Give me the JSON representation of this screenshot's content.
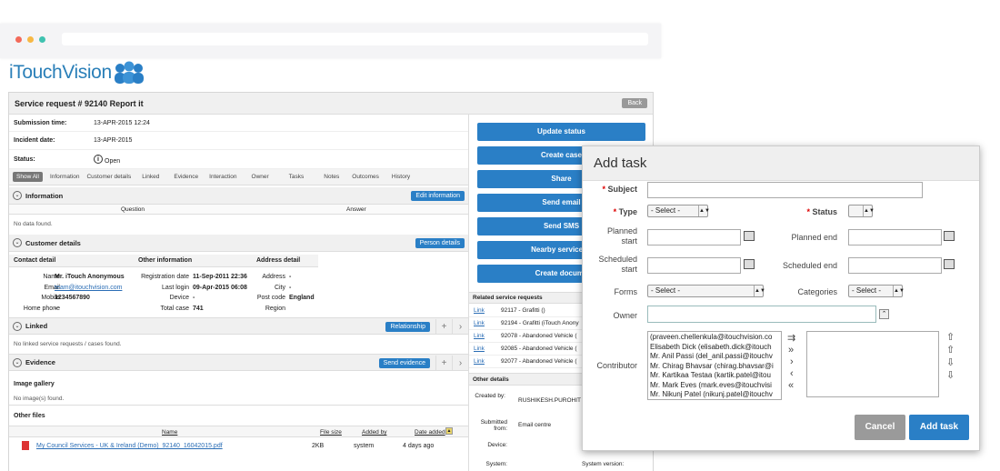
{
  "brand": {
    "name": "iTouchVision",
    "accent": "#2a7fc6"
  },
  "window": {
    "dots": [
      "#f36a5a",
      "#f7b844",
      "#3fc2b0"
    ]
  },
  "page": {
    "title": "Service request # 92140 Report it",
    "back_label": "Back"
  },
  "summary": [
    {
      "key": "Submission time:",
      "value": "13-APR-2015 12:24"
    },
    {
      "key": "Incident date:",
      "value": "13-APR-2015"
    },
    {
      "key": "Status:",
      "value": "Open"
    }
  ],
  "tabs": [
    "Show All",
    "Information",
    "Customer details",
    "Linked",
    "Evidence",
    "Interaction",
    "Owner",
    "Tasks",
    "Notes",
    "Outcomes",
    "History"
  ],
  "information": {
    "title": "Information",
    "button": "Edit information",
    "col_question": "Question",
    "col_answer": "Answer",
    "empty": "No data found."
  },
  "customer": {
    "title": "Customer details",
    "button": "Person details",
    "col_contact": "Contact detail",
    "col_other": "Other information",
    "col_address": "Address detail",
    "name_label": "Name",
    "name": "Mr. iTouch Anonymous",
    "email_label": "Email",
    "email": "team@itouchvision.com",
    "mobile_label": "Mobile",
    "mobile": "1234567890",
    "home_label": "Home phone",
    "home": "-",
    "reg_label": "Registration date",
    "reg": "11-Sep-2011 22:36",
    "login_label": "Last login",
    "login": "09-Apr-2015 06:08",
    "device_label": "Device",
    "device": "-",
    "cases_label": "Total case",
    "cases": "741",
    "address_label": "Address",
    "address": "",
    "city_label": "City",
    "city": "-",
    "post_label": "Post code",
    "post": "-",
    "region_label": "Region",
    "region": "England"
  },
  "linked": {
    "title": "Linked",
    "button": "Relationship",
    "empty": "No linked service requests / cases found."
  },
  "evidence": {
    "title": "Evidence",
    "button": "Send evidence",
    "gallery": "Image gallery",
    "gallery_empty": "No image(s) found.",
    "other_files": "Other files",
    "col_name": "Name",
    "col_size": "File size",
    "col_added_by": "Added by",
    "col_date": "Date added",
    "file": {
      "name": "My Council Services - UK & Ireland (Demo)_92140_16042015.pdf",
      "size": "2KB",
      "by": "system",
      "date": "4 days ago"
    }
  },
  "actions": [
    "Update status",
    "Create case",
    "Share",
    "Send email",
    "Send SMS",
    "Nearby service re",
    "Create docume"
  ],
  "related": {
    "title": "Related service requests",
    "items": [
      {
        "link": "Link",
        "text": "92117 - Grafitti ()"
      },
      {
        "link": "Link",
        "text": "92194 - Grafitti (iTouch Anony"
      },
      {
        "link": "Link",
        "text": "92078 - Abandoned Vehicle ("
      },
      {
        "link": "Link",
        "text": "92085 - Abandoned Vehicle ("
      },
      {
        "link": "Link",
        "text": "92077 - Abandoned Vehicle ("
      }
    ]
  },
  "other_details": {
    "title": "Other details",
    "created_label": "Created by:",
    "created": "RUSHIKESH.PUROHIT",
    "submitted_label": "Submitted from:",
    "submitted": "Email centre",
    "device_label": "Device:",
    "system_label": "System:",
    "sysver_label": "System version:"
  },
  "modal": {
    "title": "Add task",
    "subject_label": "Subject",
    "type_label": "Type",
    "type_value": "- Select -",
    "status_label": "Status",
    "status_value": "",
    "planned_start_label": "Planned start",
    "planned_end_label": "Planned end",
    "scheduled_start_label": "Scheduled start",
    "scheduled_end_label": "Scheduled end",
    "forms_label": "Forms",
    "forms_value": "- Select -",
    "categories_label": "Categories",
    "categories_value": "- Select -",
    "owner_label": "Owner",
    "contributor_label": "Contributor",
    "contributors": [
      "(praveen.chellenkula@itouchvision.co",
      "Elisabeth Dick (elisabeth.dick@itouch",
      "Mr. Anil Passi (del_anil.passi@itouchv",
      "Mr. Chirag Bhavsar (chirag.bhavsar@i",
      "Mr. Kartikaa Testaa (kartik.patel@itou",
      "Mr. Mark Eves (mark.eves@itouchvisi",
      "Mr. Nikunj Patel (nikunj.patel@itouchv"
    ],
    "cancel": "Cancel",
    "submit": "Add task"
  }
}
